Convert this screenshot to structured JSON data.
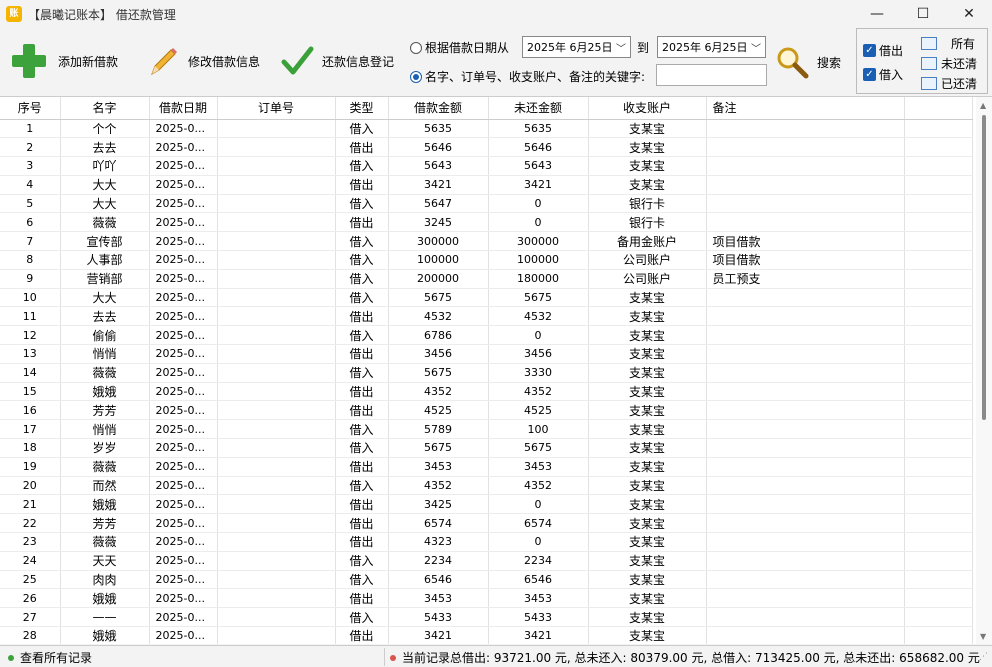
{
  "window": {
    "app_icon": "账",
    "title": "【晨曦记账本】 借还款管理",
    "minimize": "—",
    "maximize": "☐",
    "close": "✕"
  },
  "toolbar": {
    "add_label": "添加新借款",
    "edit_label": "修改借款信息",
    "repay_label": "还款信息登记",
    "search_label": "搜索",
    "date_radio_label": "根据借款日期从",
    "date_from": "2025年 6月25日",
    "to_label": "到",
    "date_to": "2025年 6月25日",
    "keyword_radio_label": "名字、订单号、收支账户、备注的关键字:",
    "keyword_value": ""
  },
  "filters": {
    "lend_label": "借出",
    "borrow_label": "借入",
    "all_label": "所有",
    "unpaid_label": "未还清",
    "paid_label": "已还清"
  },
  "table": {
    "headers": [
      "序号",
      "名字",
      "借款日期",
      "订单号",
      "类型",
      "借款金额",
      "未还金额",
      "收支账户",
      "备注"
    ],
    "rows": [
      [
        "1",
        "个个",
        "2025-0...",
        "",
        "借入",
        "5635",
        "5635",
        "支某宝",
        ""
      ],
      [
        "2",
        "去去",
        "2025-0...",
        "",
        "借出",
        "5646",
        "5646",
        "支某宝",
        ""
      ],
      [
        "3",
        "吖吖",
        "2025-0...",
        "",
        "借入",
        "5643",
        "5643",
        "支某宝",
        ""
      ],
      [
        "4",
        "大大",
        "2025-0...",
        "",
        "借出",
        "3421",
        "3421",
        "支某宝",
        ""
      ],
      [
        "5",
        "大大",
        "2025-0...",
        "",
        "借入",
        "5647",
        "0",
        "银行卡",
        ""
      ],
      [
        "6",
        "薇薇",
        "2025-0...",
        "",
        "借出",
        "3245",
        "0",
        "银行卡",
        ""
      ],
      [
        "7",
        "宣传部",
        "2025-0...",
        "",
        "借入",
        "300000",
        "300000",
        "备用金账户",
        "项目借款"
      ],
      [
        "8",
        "人事部",
        "2025-0...",
        "",
        "借入",
        "100000",
        "100000",
        "公司账户",
        "项目借款"
      ],
      [
        "9",
        "营销部",
        "2025-0...",
        "",
        "借入",
        "200000",
        "180000",
        "公司账户",
        "员工预支"
      ],
      [
        "10",
        "大大",
        "2025-0...",
        "",
        "借入",
        "5675",
        "5675",
        "支某宝",
        ""
      ],
      [
        "11",
        "去去",
        "2025-0...",
        "",
        "借出",
        "4532",
        "4532",
        "支某宝",
        ""
      ],
      [
        "12",
        "偷偷",
        "2025-0...",
        "",
        "借入",
        "6786",
        "0",
        "支某宝",
        ""
      ],
      [
        "13",
        "悄悄",
        "2025-0...",
        "",
        "借出",
        "3456",
        "3456",
        "支某宝",
        ""
      ],
      [
        "14",
        "薇薇",
        "2025-0...",
        "",
        "借入",
        "5675",
        "3330",
        "支某宝",
        ""
      ],
      [
        "15",
        "娥娥",
        "2025-0...",
        "",
        "借出",
        "4352",
        "4352",
        "支某宝",
        ""
      ],
      [
        "16",
        "芳芳",
        "2025-0...",
        "",
        "借出",
        "4525",
        "4525",
        "支某宝",
        ""
      ],
      [
        "17",
        "悄悄",
        "2025-0...",
        "",
        "借入",
        "5789",
        "100",
        "支某宝",
        ""
      ],
      [
        "18",
        "岁岁",
        "2025-0...",
        "",
        "借入",
        "5675",
        "5675",
        "支某宝",
        ""
      ],
      [
        "19",
        "薇薇",
        "2025-0...",
        "",
        "借出",
        "3453",
        "3453",
        "支某宝",
        ""
      ],
      [
        "20",
        "而然",
        "2025-0...",
        "",
        "借入",
        "4352",
        "4352",
        "支某宝",
        ""
      ],
      [
        "21",
        "娥娥",
        "2025-0...",
        "",
        "借出",
        "3425",
        "0",
        "支某宝",
        ""
      ],
      [
        "22",
        "芳芳",
        "2025-0...",
        "",
        "借出",
        "6574",
        "6574",
        "支某宝",
        ""
      ],
      [
        "23",
        "薇薇",
        "2025-0...",
        "",
        "借出",
        "4323",
        "0",
        "支某宝",
        ""
      ],
      [
        "24",
        "天天",
        "2025-0...",
        "",
        "借入",
        "2234",
        "2234",
        "支某宝",
        ""
      ],
      [
        "25",
        "肉肉",
        "2025-0...",
        "",
        "借入",
        "6546",
        "6546",
        "支某宝",
        ""
      ],
      [
        "26",
        "娥娥",
        "2025-0...",
        "",
        "借出",
        "3453",
        "3453",
        "支某宝",
        ""
      ],
      [
        "27",
        "——",
        "2025-0...",
        "",
        "借入",
        "5433",
        "5433",
        "支某宝",
        ""
      ],
      [
        "28",
        "娥娥",
        "2025-0...",
        "",
        "借出",
        "3421",
        "3421",
        "支某宝",
        ""
      ]
    ]
  },
  "status": {
    "left": "查看所有记录",
    "summary": "当前记录总借出: 93721.00 元, 总未还入: 80379.00 元, 总借入: 713425.00 元, 总未还出: 658682.00 元",
    "left_dot_color": "#3ca23c",
    "right_dot_color": "#d9534f"
  }
}
